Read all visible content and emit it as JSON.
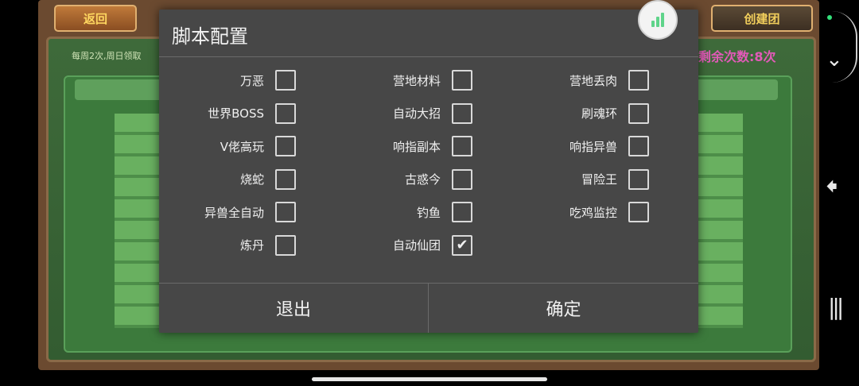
{
  "game": {
    "back_label": "返回",
    "create_label": "创建团",
    "weekly_text": "每周2次,周日领取",
    "remaining_text": "剩余次数:8次"
  },
  "dialog": {
    "title": "脚本配置",
    "columns": [
      [
        {
          "label": "万恶",
          "checked": false
        },
        {
          "label": "世界BOSS",
          "checked": false
        },
        {
          "label": "V佬高玩",
          "checked": false
        },
        {
          "label": "烧蛇",
          "checked": false
        },
        {
          "label": "异兽全自动",
          "checked": false
        },
        {
          "label": "炼丹",
          "checked": false
        }
      ],
      [
        {
          "label": "营地材料",
          "checked": false
        },
        {
          "label": "自动大招",
          "checked": false
        },
        {
          "label": "响指副本",
          "checked": false
        },
        {
          "label": "古惑今",
          "checked": false
        },
        {
          "label": "钓鱼",
          "checked": false
        },
        {
          "label": "自动仙团",
          "checked": true
        }
      ],
      [
        {
          "label": "营地丢肉",
          "checked": false
        },
        {
          "label": "刷魂环",
          "checked": false
        },
        {
          "label": "响指异兽",
          "checked": false
        },
        {
          "label": "冒险王",
          "checked": false
        },
        {
          "label": "吃鸡监控",
          "checked": false
        }
      ]
    ],
    "exit_label": "退出",
    "confirm_label": "确定"
  },
  "icons": {
    "float_widget": "signal-bars-icon",
    "system": [
      "chevron-down-icon",
      "back-arrow-icon",
      "recent-apps-icon"
    ]
  },
  "colors": {
    "dialog_bg": "#474747",
    "accent_green": "#5fd48a",
    "remaining_pink": "#e25ab8"
  }
}
